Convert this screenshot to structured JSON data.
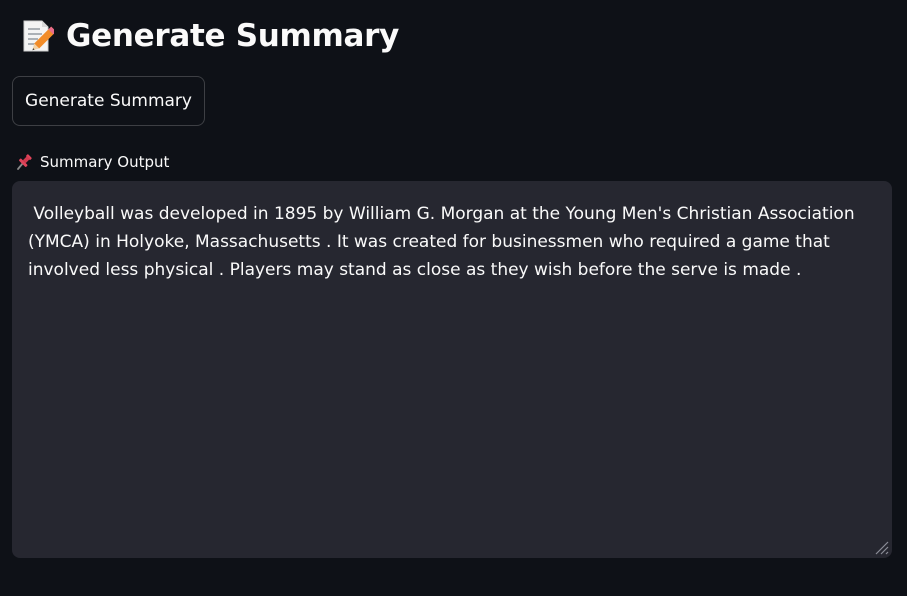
{
  "header": {
    "icon": "memo-pencil-icon",
    "title": "Generate Summary"
  },
  "actions": {
    "generate_label": "Generate Summary"
  },
  "output": {
    "icon": "pushpin-icon",
    "label": "Summary Output",
    "text": " Volleyball was developed in 1895 by William G. Morgan at the Young Men's Christian Association (YMCA) in Holyoke, Massachusetts . It was created for businessmen who required a game that involved less physical . Players may stand as close as they wish before the serve is made ."
  },
  "colors": {
    "background": "#0e1117",
    "text": "#fafafa",
    "input_background": "#262730",
    "accent_pin": "#e0445a"
  }
}
